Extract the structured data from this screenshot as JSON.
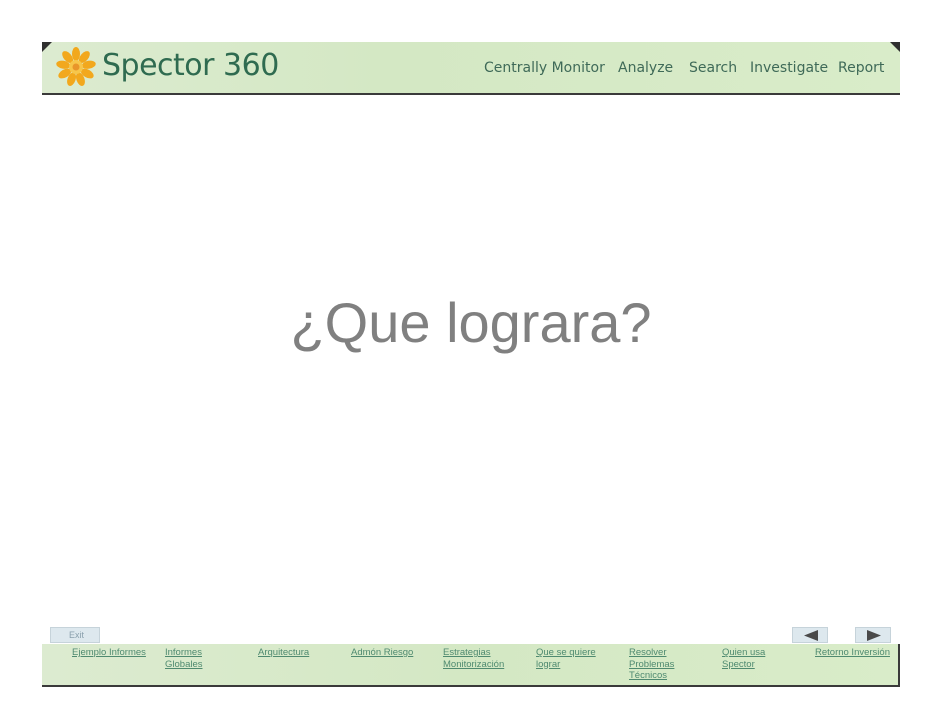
{
  "header": {
    "brand": "Spector 360",
    "nav": [
      "Centrally Monitor",
      "Analyze",
      "Search",
      "Investigate",
      "Report"
    ]
  },
  "slide": {
    "title": "¿Que lograra?"
  },
  "controls": {
    "exit_label": "Exit",
    "prev_icon": "triangle-left-icon",
    "next_icon": "triangle-right-icon"
  },
  "links": [
    {
      "line1": "Ejemplo Informes",
      "line2": "",
      "line3": ""
    },
    {
      "line1": "Informes",
      "line2": "Globales",
      "line3": ""
    },
    {
      "line1": "Arquitectura",
      "line2": "",
      "line3": ""
    },
    {
      "line1": "Admón Riesgo",
      "line2": "",
      "line3": ""
    },
    {
      "line1": "Estrategias",
      "line2": "Monitorización",
      "line3": ""
    },
    {
      "line1": "Que se quiere",
      "line2": "lograr",
      "line3": ""
    },
    {
      "line1": "Resolver",
      "line2": "Problemas",
      "line3": "Técnicos"
    },
    {
      "line1": "Quien usa",
      "line2": "Spector",
      "line3": ""
    },
    {
      "line1": "Retorno Inversión",
      "line2": "",
      "line3": ""
    }
  ],
  "colors": {
    "banner": "#d4e8c4",
    "brand_text": "#2f6b50",
    "link_text": "#4f8a70",
    "title_text": "#808080",
    "logo_orange": "#f2a81d"
  }
}
